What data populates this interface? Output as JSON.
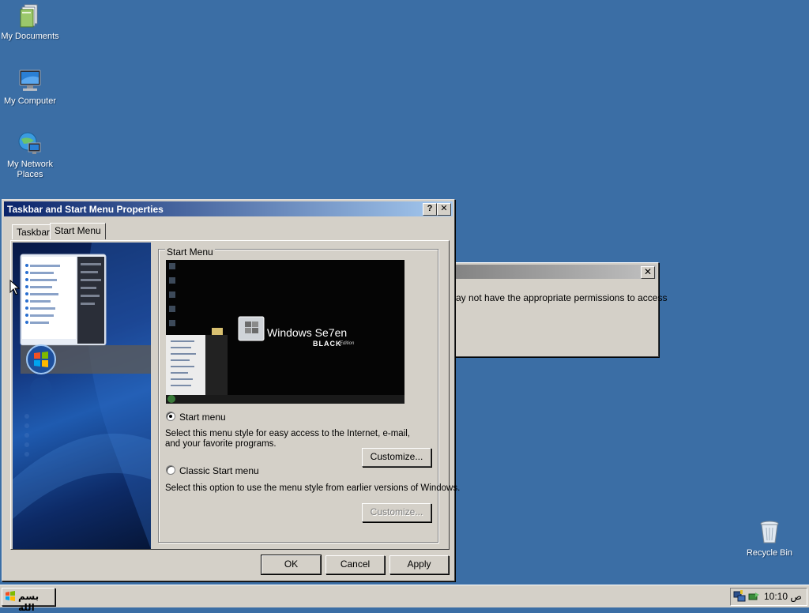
{
  "desktop": {
    "icons": [
      {
        "label": "My Documents",
        "icon": "my-documents-icon"
      },
      {
        "label": "My Computer",
        "icon": "my-computer-icon"
      },
      {
        "label": "My Network Places",
        "icon": "my-network-places-icon"
      },
      {
        "label": "Recycle Bin",
        "icon": "recycle-bin-icon"
      }
    ]
  },
  "error_dialog": {
    "text": "ay not have the appropriate permissions to access",
    "close_glyph": "✕"
  },
  "dialog": {
    "title": "Taskbar and Start Menu Properties",
    "help_glyph": "?",
    "close_glyph": "✕",
    "tabs": [
      {
        "label": "Taskbar",
        "selected": false
      },
      {
        "label": "Start Menu",
        "selected": true
      }
    ],
    "group_title": "Start Menu",
    "preview_branding": {
      "windows": "Windows Se7en",
      "black": "BLACK",
      "edition": "Edition"
    },
    "options": [
      {
        "label": "Start menu",
        "selected": true,
        "description": "Select this menu style for easy access to the Internet, e-mail, and your favorite programs.",
        "customize_label": "Customize...",
        "customize_enabled": true
      },
      {
        "label": "Classic Start menu",
        "selected": false,
        "description": "Select this option to use the menu style from earlier versions of Windows.",
        "customize_label": "Customize...",
        "customize_enabled": false
      }
    ],
    "buttons": {
      "ok": "OK",
      "cancel": "Cancel",
      "apply": "Apply"
    }
  },
  "taskbar": {
    "start_label": "بسم الله",
    "clock": "10:10 ص"
  },
  "colors": {
    "desktop": "#3b6ea5",
    "titlebar_start": "#0a246a",
    "titlebar_end": "#a6caf0",
    "face": "#d4d0c8"
  }
}
